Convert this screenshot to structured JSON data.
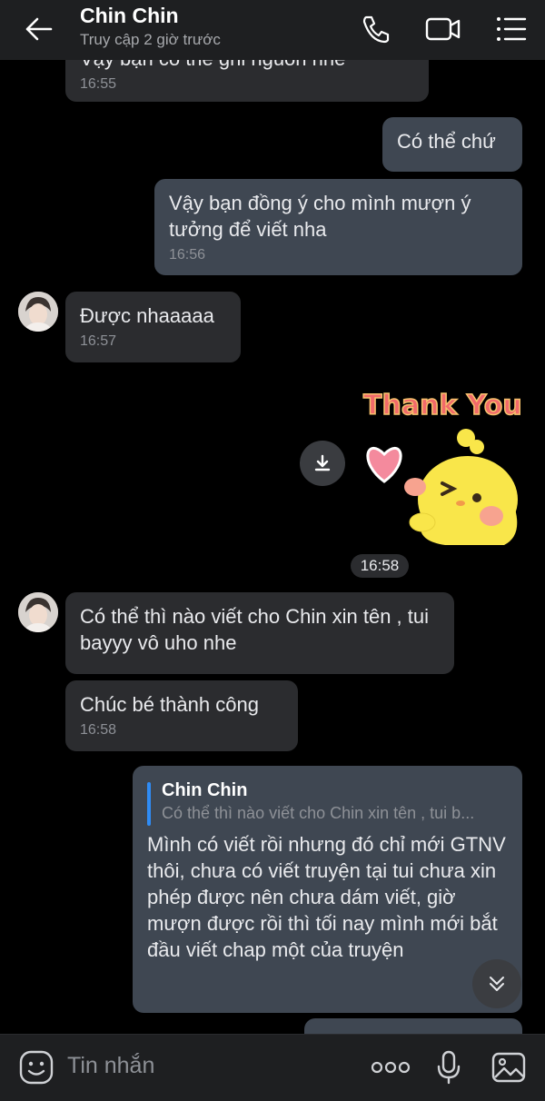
{
  "header": {
    "contact_name": "Chin Chin",
    "status": "Truy cập 2 giờ trước",
    "icons": [
      "back-arrow-icon",
      "phone-icon",
      "video-call-icon",
      "menu-icon"
    ]
  },
  "messages": [
    {
      "direction": "in",
      "text": "Vậy bạn có thể ghi nguồn nhé",
      "time": "16:55"
    },
    {
      "direction": "out",
      "text": "Có thể chứ",
      "time": ""
    },
    {
      "direction": "out",
      "text": "Vậy bạn đồng ý cho mình mượn ý tưởng để viết nha",
      "time": "16:56"
    },
    {
      "direction": "in",
      "text": "Được nhaaaaa",
      "time": "16:57"
    },
    {
      "direction": "out",
      "sticker_text": "Thank You",
      "time": "16:58"
    },
    {
      "direction": "in",
      "text": "Có thể thì nào viết cho Chin xin tên , tui bayyy vô uho nhe",
      "time": ""
    },
    {
      "direction": "in",
      "text": "Chúc bé thành công",
      "time": "16:58"
    },
    {
      "direction": "out",
      "quote": {
        "name": "Chin Chin",
        "text": "Có thể thì nào viết cho Chin xin tên , tui b..."
      },
      "text": "Mình có viết rồi nhưng đó chỉ mới GTNV thôi, chưa có viết truyện tại tui chưa xin phép được nên chưa dám viết, giờ mượn được rồi thì tối nay mình mới bắt đầu viết chap một của truyện",
      "time": ""
    }
  ],
  "input": {
    "placeholder": "Tin nhắn"
  },
  "colors": {
    "background": "#000000",
    "header": "#1e1f21",
    "incoming_bubble": "#2b2c2f",
    "outgoing_bubble": "#3f4752",
    "quote_accent": "#2f8cf5"
  }
}
